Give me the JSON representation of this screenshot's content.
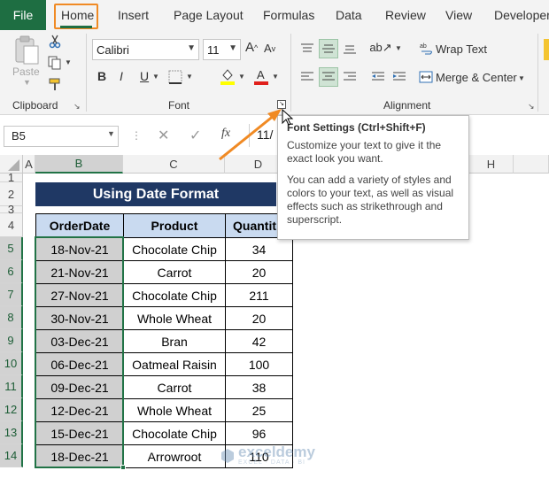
{
  "menu": {
    "tabs": [
      "File",
      "Home",
      "Insert",
      "Page Layout",
      "Formulas",
      "Data",
      "Review",
      "View",
      "Developer"
    ]
  },
  "ribbon": {
    "clipboard": {
      "paste_label": "Paste",
      "group_label": "Clipboard"
    },
    "font": {
      "font_name": "Calibri",
      "font_size": "11",
      "bold": "B",
      "italic": "I",
      "underline": "U",
      "grow": "A",
      "shrink": "A",
      "group_label": "Font"
    },
    "alignment": {
      "wrap_text": "Wrap Text",
      "merge_center": "Merge & Center",
      "group_label": "Alignment"
    }
  },
  "formula_bar": {
    "name_box": "B5",
    "fx": "fx",
    "value": "11/"
  },
  "columns": [
    "A",
    "B",
    "C",
    "D",
    "H"
  ],
  "rows": [
    "1",
    "2",
    "3",
    "4",
    "5",
    "6",
    "7",
    "8",
    "9",
    "10",
    "11",
    "12",
    "13",
    "14"
  ],
  "sheet": {
    "title": "Using Date Format",
    "headers": [
      "OrderDate",
      "Product",
      "Quantit"
    ],
    "data": [
      [
        "18-Nov-21",
        "Chocolate Chip",
        "34"
      ],
      [
        "21-Nov-21",
        "Carrot",
        "20"
      ],
      [
        "27-Nov-21",
        "Chocolate Chip",
        "211"
      ],
      [
        "30-Nov-21",
        "Whole Wheat",
        "20"
      ],
      [
        "03-Dec-21",
        "Bran",
        "42"
      ],
      [
        "06-Dec-21",
        "Oatmeal Raisin",
        "100"
      ],
      [
        "09-Dec-21",
        "Carrot",
        "38"
      ],
      [
        "12-Dec-21",
        "Whole Wheat",
        "25"
      ],
      [
        "15-Dec-21",
        "Chocolate Chip",
        "96"
      ],
      [
        "18-Dec-21",
        "Arrowroot",
        "110"
      ]
    ]
  },
  "tooltip": {
    "title": "Font Settings (Ctrl+Shift+F)",
    "line1": "Customize your text to give it the exact look you want.",
    "line2": "You can add a variety of styles and colors to your text, as well as visual effects such as strikethrough and superscript."
  },
  "watermark": {
    "brand": "exceldemy",
    "tagline": "EXCEL · DATA · BI"
  },
  "colors": {
    "accent_green": "#217346",
    "title_fill": "#1f3864",
    "header_fill": "#c9daf0",
    "highlight_orange": "#f08a24"
  }
}
